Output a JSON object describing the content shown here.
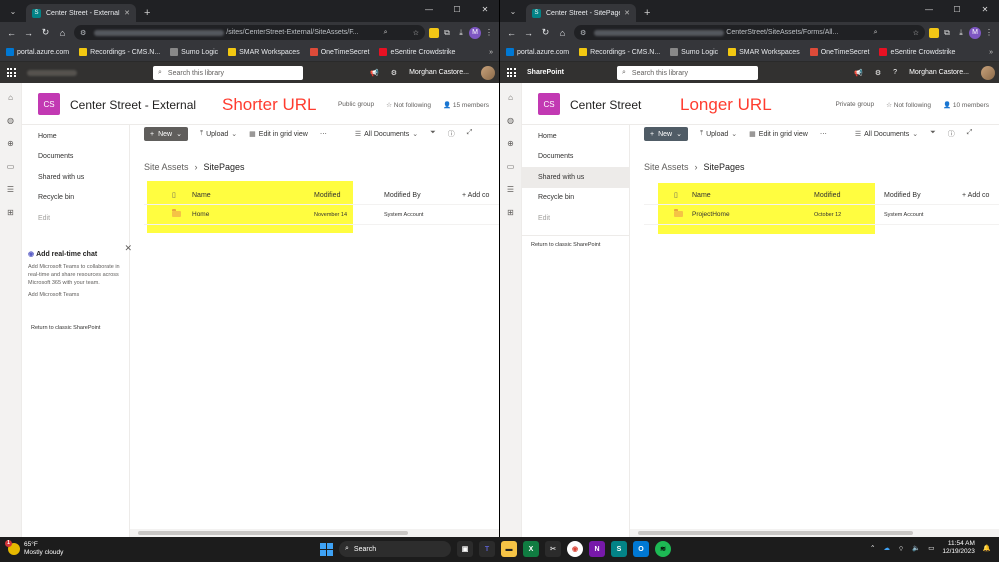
{
  "bookmarks": [
    {
      "label": "portal.azure.com",
      "color": "#0078d4"
    },
    {
      "label": "Recordings - CMS.N...",
      "color": "#f2c811"
    },
    {
      "label": "Sumo Logic",
      "color": "#1a1a1a"
    },
    {
      "label": "SMAR Workspaces",
      "color": "#2b88d8"
    },
    {
      "label": "OneTimeSecret",
      "color": "#dd4b39"
    },
    {
      "label": "eSentire Crowdstrike",
      "color": "#e81123"
    }
  ],
  "left": {
    "tab_title": "Center Street - External - SitePa",
    "url_visible": "/sites/CenterStreet-External/SiteAssets/F...",
    "suite_brand": "",
    "search_placeholder": "Search this library",
    "user_name": "Morghan Castore...",
    "site_logo": "CS",
    "site_title": "Center Street - External",
    "annotation": "Shorter URL",
    "group_type": "Public group",
    "follow": "Not following",
    "members": "15 members",
    "nav": [
      "Home",
      "Documents",
      "Shared with us",
      "Recycle bin",
      "Edit"
    ],
    "chat": {
      "title": "Add real-time chat",
      "body": "Add Microsoft Teams to collaborate in real-time and share resources across Microsoft 365 with your team.",
      "link": "Add Microsoft Teams"
    },
    "classic_link": "Return to classic SharePoint",
    "breadcrumb": [
      "Site Assets",
      "SitePages"
    ],
    "columns": {
      "name": "Name",
      "modified": "Modified",
      "modified_by": "Modified By",
      "add": "+ Add co"
    },
    "rows": [
      {
        "name": "Home",
        "modified": "November 14",
        "modified_by": "System Account"
      }
    ]
  },
  "right": {
    "tab_title": "Center Street - SitePages - All D",
    "url_visible": "CenterStreet/SiteAssets/Forms/All...",
    "suite_brand": "SharePoint",
    "search_placeholder": "Search this library",
    "user_name": "Morghan Castore...",
    "site_logo": "CS",
    "site_title": "Center Street",
    "annotation": "Longer URL",
    "group_type": "Private group",
    "follow": "Not following",
    "members": "10 members",
    "nav": [
      "Home",
      "Documents",
      "Shared with us",
      "Recycle bin",
      "Edit"
    ],
    "classic_link": "Return to classic SharePoint",
    "breadcrumb": [
      "Site Assets",
      "SitePages"
    ],
    "columns": {
      "name": "Name",
      "modified": "Modified",
      "modified_by": "Modified By",
      "add": "+ Add co"
    },
    "rows": [
      {
        "name": "ProjectHome",
        "modified": "October 12",
        "modified_by": "System Account"
      }
    ]
  },
  "commands": {
    "new": "New",
    "upload": "Upload",
    "grid": "Edit in grid view",
    "view": "All Documents"
  },
  "taskbar": {
    "temp": "65°F",
    "weather": "Mostly cloudy",
    "badge": "1",
    "search": "Search",
    "time": "11:54 AM",
    "date": "12/19/2023"
  },
  "colors": {
    "site_logo": "#c239b3",
    "highlight": "#fffc00",
    "annotation": "#ff3c2f"
  }
}
